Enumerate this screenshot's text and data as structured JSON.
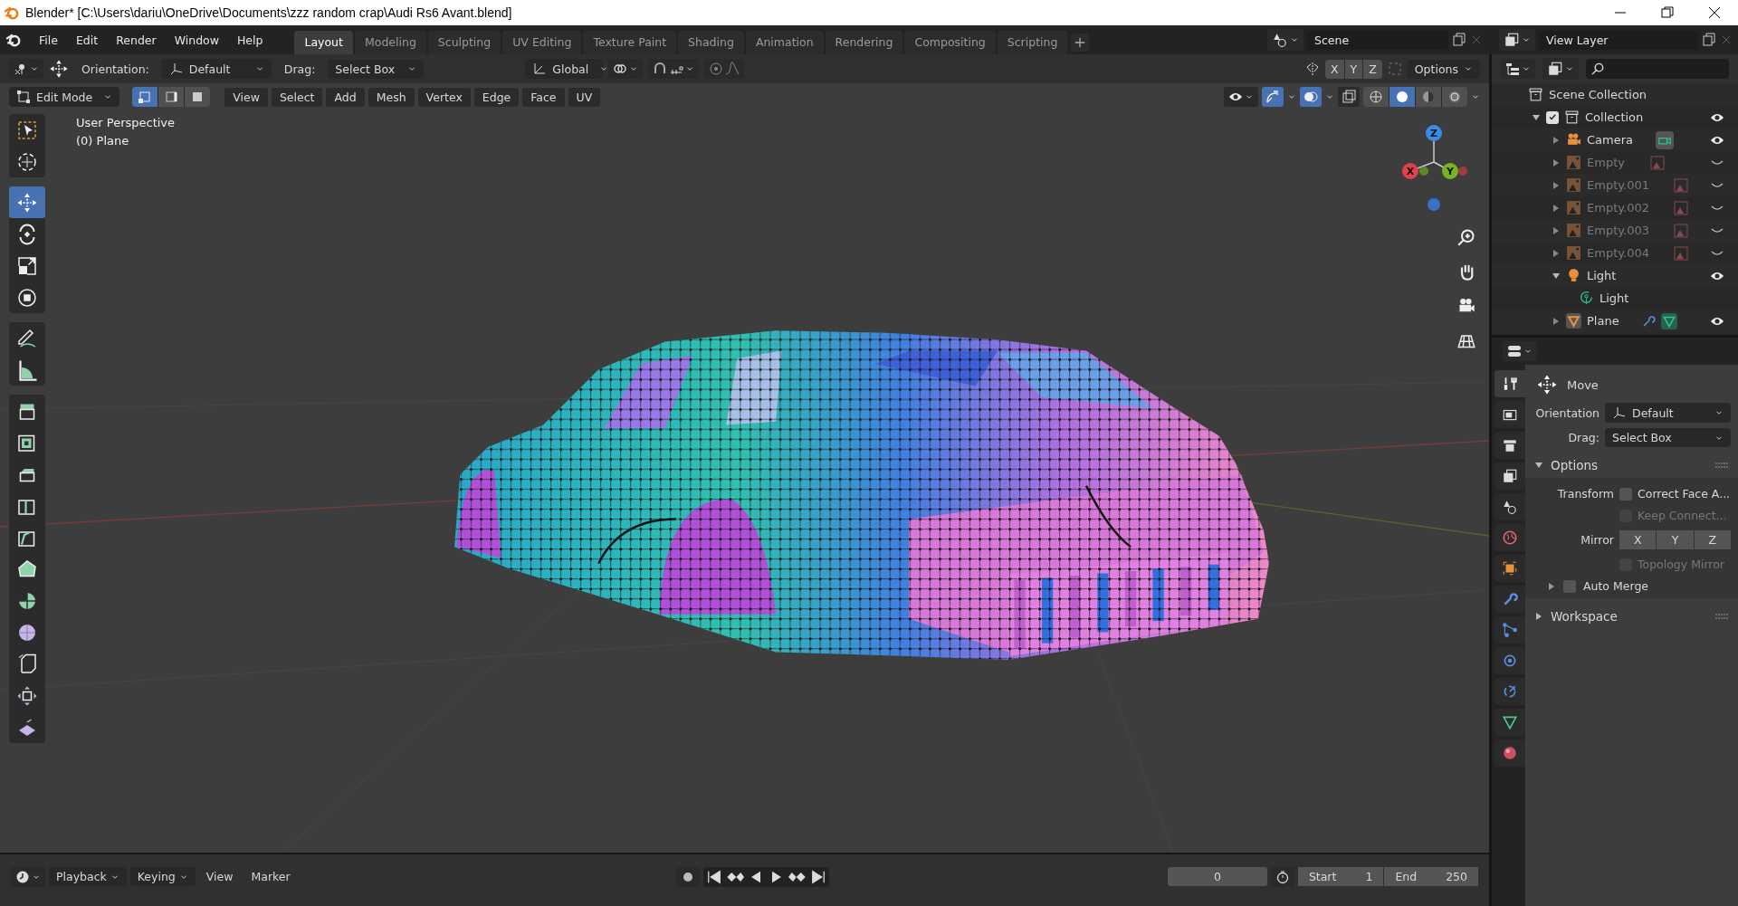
{
  "window": {
    "title": "Blender* [C:\\Users\\dariu\\OneDrive\\Documents\\zzz random crap\\Audi Rs6 Avant.blend]"
  },
  "top_bar": {
    "menus": [
      "File",
      "Edit",
      "Render",
      "Window",
      "Help"
    ],
    "workspaces": [
      {
        "label": "Layout",
        "selected": true
      },
      {
        "label": "Modeling",
        "selected": false
      },
      {
        "label": "Sculpting",
        "selected": false
      },
      {
        "label": "UV Editing",
        "selected": false
      },
      {
        "label": "Texture Paint",
        "selected": false
      },
      {
        "label": "Shading",
        "selected": false
      },
      {
        "label": "Animation",
        "selected": false
      },
      {
        "label": "Rendering",
        "selected": false
      },
      {
        "label": "Compositing",
        "selected": false
      },
      {
        "label": "Scripting",
        "selected": false
      }
    ],
    "scene": "Scene",
    "view_layer": "View Layer"
  },
  "tool_header": {
    "orientation_label": "Orientation:",
    "orientation": "Default",
    "drag_label": "Drag:",
    "drag": "Select Box",
    "transform_orientation": "Global",
    "proportional_on": false,
    "mirror_axes": [
      "X",
      "Y",
      "Z"
    ],
    "options": "Options"
  },
  "viewport_header": {
    "mode": "Edit Mode",
    "select_modes": [
      {
        "kind": "vertex",
        "selected": true
      },
      {
        "kind": "edge",
        "selected": false
      },
      {
        "kind": "face",
        "selected": false
      }
    ],
    "menus": [
      "View",
      "Select",
      "Add",
      "Mesh",
      "Vertex",
      "Edge",
      "Face",
      "UV"
    ],
    "gizmos_on": true,
    "overlays_on": true,
    "shading": [
      {
        "kind": "wireframe",
        "selected": false
      },
      {
        "kind": "solid",
        "selected": true
      },
      {
        "kind": "material",
        "selected": false
      },
      {
        "kind": "rendered",
        "selected": false
      }
    ]
  },
  "toolbar": {
    "tool_groups": [
      [
        {
          "kind": "select-box",
          "selected": false
        },
        {
          "kind": "cursor",
          "selected": false
        }
      ],
      [
        {
          "kind": "move",
          "selected": true
        },
        {
          "kind": "rotate",
          "selected": false
        },
        {
          "kind": "scale",
          "selected": false
        },
        {
          "kind": "transform",
          "selected": false
        }
      ],
      [
        {
          "kind": "annotate",
          "selected": false
        },
        {
          "kind": "measure",
          "selected": false
        }
      ],
      [
        {
          "kind": "extrude",
          "selected": false
        },
        {
          "kind": "inset",
          "selected": false
        },
        {
          "kind": "bevel",
          "selected": false
        },
        {
          "kind": "loop-cut",
          "selected": false
        },
        {
          "kind": "knife",
          "selected": false
        },
        {
          "kind": "poly-build",
          "selected": false
        },
        {
          "kind": "spin",
          "selected": false
        },
        {
          "kind": "smooth",
          "selected": false
        },
        {
          "kind": "edge-slide",
          "selected": false
        },
        {
          "kind": "shrink",
          "selected": false
        },
        {
          "kind": "shear",
          "selected": false
        }
      ]
    ]
  },
  "viewport": {
    "view_name": "User Perspective",
    "object_info": "(0) Plane",
    "gizmo_axes": [
      "X",
      "Y",
      "Z"
    ]
  },
  "outliner": {
    "root": "Scene Collection",
    "tree": [
      {
        "name": "Collection",
        "kind": "collection",
        "checked": true,
        "expanded": true,
        "visible": true,
        "children": [
          {
            "name": "Camera",
            "kind": "camera",
            "expanded": false,
            "visible": true
          },
          {
            "name": "Empty",
            "kind": "empty",
            "expanded": false,
            "visible": false
          },
          {
            "name": "Empty.001",
            "kind": "empty",
            "expanded": false,
            "visible": false
          },
          {
            "name": "Empty.002",
            "kind": "empty",
            "expanded": false,
            "visible": false
          },
          {
            "name": "Empty.003",
            "kind": "empty",
            "expanded": false,
            "visible": false
          },
          {
            "name": "Empty.004",
            "kind": "empty",
            "expanded": false,
            "visible": false
          },
          {
            "name": "Light",
            "kind": "light",
            "expanded": true,
            "visible": true,
            "children": [
              {
                "name": "Light",
                "kind": "light-data"
              }
            ]
          },
          {
            "name": "Plane",
            "kind": "mesh",
            "expanded": false,
            "visible": true
          }
        ]
      }
    ]
  },
  "properties": {
    "tabs": [
      {
        "kind": "tool",
        "selected": true
      },
      {
        "kind": "render",
        "selected": false
      },
      {
        "kind": "output",
        "selected": false
      },
      {
        "kind": "view-layer",
        "selected": false
      },
      {
        "kind": "scene",
        "selected": false
      },
      {
        "kind": "world",
        "selected": false
      },
      {
        "kind": "object",
        "selected": false
      },
      {
        "kind": "modifiers",
        "selected": false
      },
      {
        "kind": "particles",
        "selected": false
      },
      {
        "kind": "physics",
        "selected": false
      },
      {
        "kind": "constraints",
        "selected": false
      },
      {
        "kind": "data",
        "selected": false
      },
      {
        "kind": "material",
        "selected": false
      }
    ],
    "tool": {
      "name": "Move",
      "orientation_label": "Orientation",
      "orientation": "Default",
      "drag_label": "Drag:",
      "drag": "Select Box"
    },
    "panels": [
      {
        "title": "Options",
        "expanded": true,
        "rows": [
          {
            "kind": "checkbox",
            "label": "Transform",
            "text": "Correct Face A...",
            "checked": false,
            "disabled": false
          },
          {
            "kind": "checkbox",
            "text": "Keep Connect...",
            "checked": false,
            "disabled": true
          },
          {
            "kind": "axes",
            "label": "Mirror",
            "axes": [
              "X",
              "Y",
              "Z"
            ]
          },
          {
            "kind": "checkbox",
            "text": "Topology Mirror",
            "checked": false,
            "disabled": true
          }
        ],
        "subpanel": {
          "title": "Auto Merge",
          "expanded": false,
          "checked": false
        }
      },
      {
        "title": "Workspace",
        "expanded": false
      }
    ]
  },
  "timeline": {
    "menus": [
      {
        "label": "Playback",
        "dropdown": true
      },
      {
        "label": "Keying",
        "dropdown": true
      },
      {
        "label": "View",
        "dropdown": false
      },
      {
        "label": "Marker",
        "dropdown": false
      }
    ],
    "current_frame": "0",
    "start_label": "Start",
    "start": "1",
    "end_label": "End",
    "end": "250"
  }
}
